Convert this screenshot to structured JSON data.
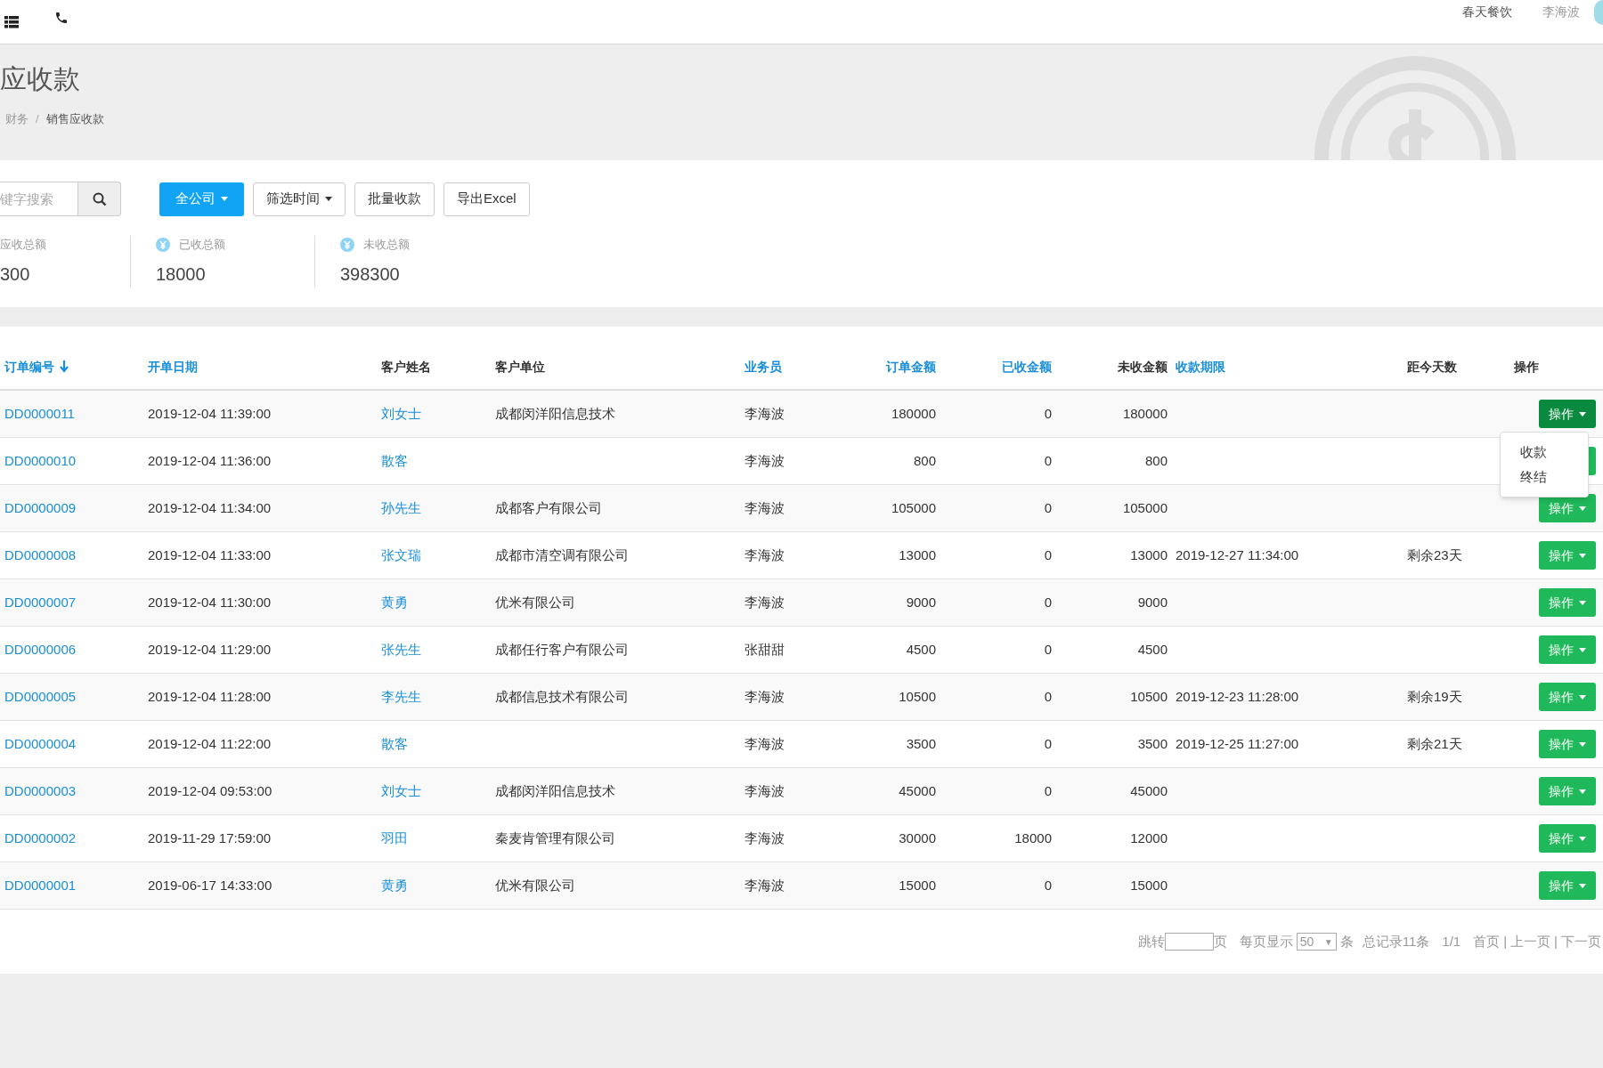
{
  "topbar": {
    "company": "春天餐饮",
    "user": "李海波"
  },
  "header": {
    "title": "应收款",
    "breadcrumb": [
      "财务",
      "销售应收款"
    ],
    "separator": "/"
  },
  "toolbar": {
    "search_placeholder": "键字搜索",
    "buttons": [
      {
        "label": "全公司",
        "kind": "primary",
        "caret": true
      },
      {
        "label": "筛选时间",
        "kind": "default",
        "caret": true
      },
      {
        "label": "批量收款",
        "kind": "default",
        "caret": false
      },
      {
        "label": "导出Excel",
        "kind": "default",
        "caret": false
      }
    ]
  },
  "stats": [
    {
      "label": "应收总额",
      "value": "300",
      "icon": false
    },
    {
      "label": "已收总额",
      "value": "18000",
      "icon": true
    },
    {
      "label": "未收总额",
      "value": "398300",
      "icon": true
    }
  ],
  "table": {
    "columns": [
      {
        "label": "订单编号",
        "sortable": true,
        "sorted": true
      },
      {
        "label": "开单日期",
        "sortable": true,
        "sorted": false
      },
      {
        "label": "客户姓名",
        "sortable": false,
        "sorted": false
      },
      {
        "label": "客户单位",
        "sortable": false,
        "sorted": false
      },
      {
        "label": "业务员",
        "sortable": true,
        "sorted": false
      },
      {
        "label": "订单金额",
        "sortable": true,
        "sorted": false
      },
      {
        "label": "已收金额",
        "sortable": true,
        "sorted": false
      },
      {
        "label": "未收金额",
        "sortable": false,
        "sorted": false
      },
      {
        "label": "收款期限",
        "sortable": true,
        "sorted": false
      },
      {
        "label": "距今天数",
        "sortable": false,
        "sorted": false
      },
      {
        "label": "操作",
        "sortable": false,
        "sorted": false
      }
    ],
    "rows": [
      {
        "cells": [
          "DD0000011",
          "2019-12-04 11:39:00",
          "刘女士",
          "成都闵洋阳信息技术",
          "李海波",
          "180000",
          "0",
          "180000",
          "",
          ""
        ],
        "action": "操作",
        "open": true
      },
      {
        "cells": [
          "DD0000010",
          "2019-12-04 11:36:00",
          "散客",
          "",
          "李海波",
          "800",
          "0",
          "800",
          "",
          ""
        ],
        "open": false
      },
      {
        "cells": [
          "DD0000009",
          "2019-12-04 11:34:00",
          "孙先生",
          "成都客户有限公司",
          "李海波",
          "105000",
          "0",
          "105000",
          "",
          ""
        ],
        "action": "操作",
        "open": false
      },
      {
        "cells": [
          "DD0000008",
          "2019-12-04 11:33:00",
          "张文瑞",
          "成都市清空调有限公司",
          "李海波",
          "13000",
          "0",
          "13000",
          "2019-12-27 11:34:00",
          "剩余23天"
        ],
        "action": "操作",
        "open": false
      },
      {
        "cells": [
          "DD0000007",
          "2019-12-04 11:30:00",
          "黄勇",
          "优米有限公司",
          "李海波",
          "9000",
          "0",
          "9000",
          "",
          ""
        ],
        "action": "操作",
        "open": false
      },
      {
        "cells": [
          "DD0000006",
          "2019-12-04 11:29:00",
          "张先生",
          "成都任行客户有限公司",
          "张甜甜",
          "4500",
          "0",
          "4500",
          "",
          ""
        ],
        "action": "操作",
        "open": false
      },
      {
        "cells": [
          "DD0000005",
          "2019-12-04 11:28:00",
          "李先生",
          "成都信息技术有限公司",
          "李海波",
          "10500",
          "0",
          "10500",
          "2019-12-23 11:28:00",
          "剩余19天"
        ],
        "action": "操作",
        "open": false
      },
      {
        "cells": [
          "DD0000004",
          "2019-12-04 11:22:00",
          "散客",
          "",
          "李海波",
          "3500",
          "0",
          "3500",
          "2019-12-25 11:27:00",
          "剩余21天"
        ],
        "action": "操作",
        "open": false
      },
      {
        "cells": [
          "DD0000003",
          "2019-12-04 09:53:00",
          "刘女士",
          "成都闵洋阳信息技术",
          "李海波",
          "45000",
          "0",
          "45000",
          "",
          ""
        ],
        "action": "操作",
        "open": false
      },
      {
        "cells": [
          "DD0000002",
          "2019-11-29 17:59:00",
          "羽田",
          "秦麦肯管理有限公司",
          "李海波",
          "30000",
          "18000",
          "12000",
          "",
          ""
        ],
        "action": "操作",
        "open": false
      },
      {
        "cells": [
          "DD0000001",
          "2019-06-17 14:33:00",
          "黄勇",
          "优米有限公司",
          "李海波",
          "15000",
          "0",
          "15000",
          "",
          ""
        ],
        "action": "操作",
        "open": false
      }
    ],
    "menu": [
      "收款",
      "终结"
    ]
  },
  "pagination": {
    "jump_label": "跳转",
    "page_unit": "页",
    "per_page_label": "每页显示",
    "per_page": "50",
    "caret": "▼",
    "per_page_unit": "条",
    "total": "总记录11条",
    "page": "1/1",
    "links": [
      "首页",
      "上一页",
      "下一页"
    ],
    "separator": "|"
  }
}
